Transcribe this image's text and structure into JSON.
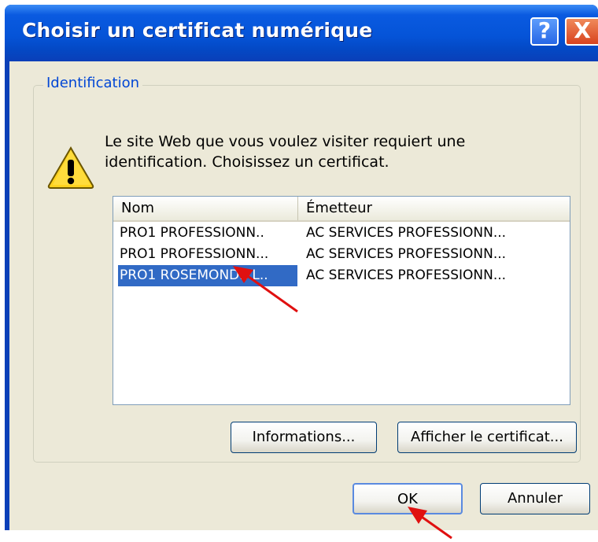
{
  "dialog": {
    "title": "Choisir un certificat numérique",
    "help_glyph": "?",
    "close_glyph": "X"
  },
  "group": {
    "label": "Identification",
    "message": "Le site Web que vous voulez visiter requiert une identification. Choisissez un certificat."
  },
  "list": {
    "columns": [
      "Nom",
      "Émetteur"
    ],
    "rows": [
      {
        "name": "PRO1 PROFESSIONN..",
        "issuer": "AC SERVICES PROFESSIONN..."
      },
      {
        "name": "PRO1 PROFESSIONN...",
        "issuer": "AC SERVICES PROFESSIONN..."
      },
      {
        "name": "PRO1 ROSEMONDE L..",
        "issuer": "AC SERVICES PROFESSIONN...",
        "selected": true
      }
    ]
  },
  "buttons": {
    "informations": "Informations...",
    "show_certificate": "Afficher le certificat...",
    "ok": "OK",
    "cancel": "Annuler"
  },
  "colors": {
    "title_bar": "#0554d8",
    "selection": "#316ac5",
    "annotation_arrow": "#e01010"
  }
}
